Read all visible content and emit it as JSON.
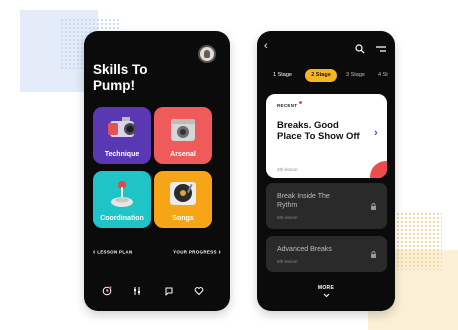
{
  "left_screen": {
    "title": "Skills To Pump!",
    "tiles": [
      {
        "label": "Technique",
        "color": "#5a37b3",
        "icon": "video-camera-icon"
      },
      {
        "label": "Arsenal",
        "color": "#ef5a5a",
        "icon": "amplifier-icon"
      },
      {
        "label": "Coordination",
        "color": "#1fc4c7",
        "icon": "joystick-icon"
      },
      {
        "label": "Songs",
        "color": "#f6a517",
        "icon": "vinyl-record-icon"
      }
    ],
    "lesson_plan": "LESSON PLAN",
    "your_progress": "YOUR PROGRESS",
    "bottom_nav": [
      "clock-icon",
      "sliders-icon",
      "chat-icon",
      "heart-icon"
    ]
  },
  "right_screen": {
    "stages": [
      "1 Stage",
      "2 Stage",
      "3 Stage",
      "4 St"
    ],
    "active_stage": "2 Stage",
    "recent": {
      "label": "RECENT",
      "title": "Breaks. Good Place To Show Off",
      "subtitle": "4th lesson"
    },
    "lessons": [
      {
        "title": "Break Inside The Rythm",
        "subtitle": "5th lesson",
        "locked": true
      },
      {
        "title": "Advanced Breaks",
        "subtitle": "6th lesson",
        "locked": true
      }
    ],
    "more_label": "MORE"
  },
  "colors": {
    "accent_yellow": "#f6b522",
    "accent_red": "#ef4b4b",
    "chevron_blue": "#3b54d9",
    "background_dark": "#0b0b0b"
  }
}
